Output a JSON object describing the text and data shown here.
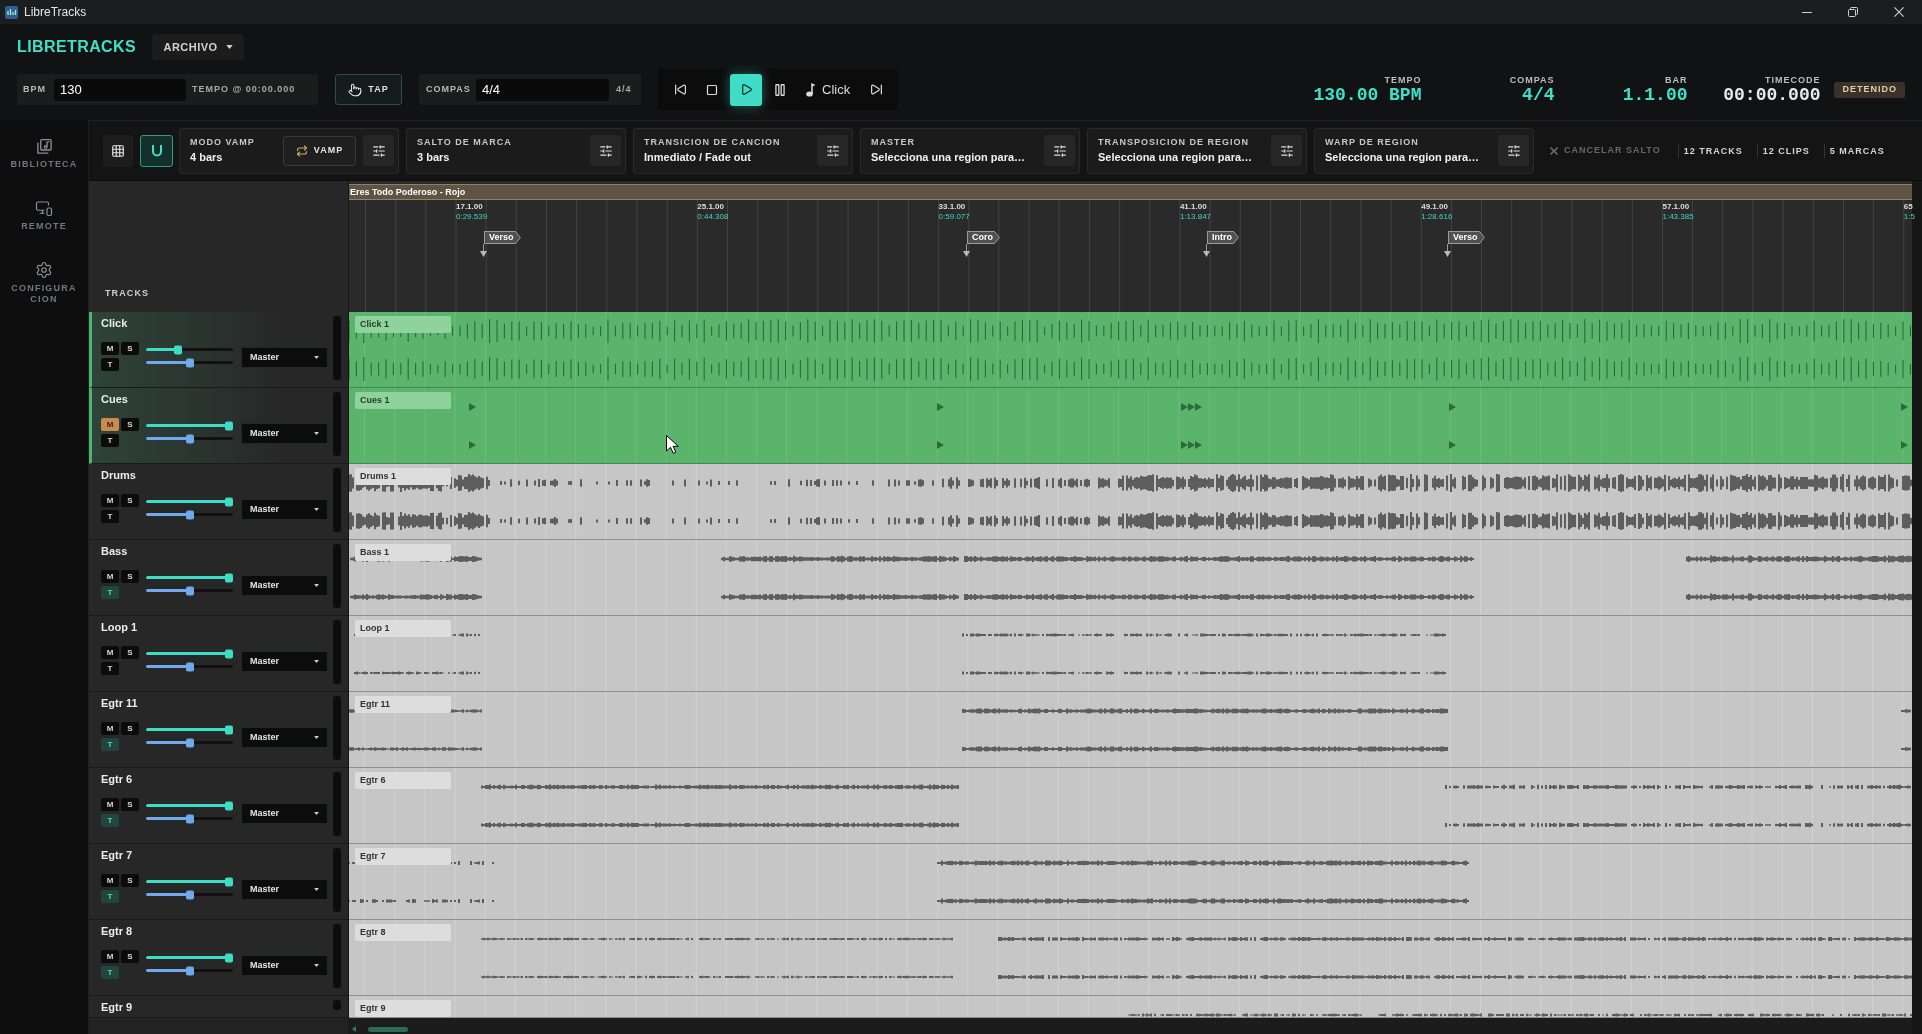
{
  "window": {
    "title": "LibreTracks"
  },
  "header": {
    "logo": "LIBRETRACKS",
    "menu": "ARCHIVO",
    "bpm": {
      "label": "BPM",
      "value": "130",
      "note": "TEMPO @ 00:00.000"
    },
    "tap": "TAP",
    "meter": {
      "label": "COMPAS",
      "value": "4/4",
      "note": "4/4"
    },
    "transport": [
      {
        "kind": "prev",
        "selected": false
      },
      {
        "kind": "stop",
        "selected": false
      },
      {
        "kind": "play",
        "selected": true
      },
      {
        "kind": "pause",
        "selected": false
      },
      {
        "kind": "click",
        "label": "Click",
        "selected": false
      },
      {
        "kind": "next",
        "selected": false
      }
    ],
    "readouts": [
      {
        "label": "TEMPO",
        "value": "130.00 BPM",
        "color": "#3fe0c7"
      },
      {
        "label": "COMPAS",
        "value": "4/4",
        "color": "#3fe0c7"
      },
      {
        "label": "BAR",
        "value": "1.1.00",
        "color": "#3fe0c7"
      },
      {
        "label": "TIMECODE",
        "value": "00:00.000",
        "color": "#e8e8e8"
      }
    ],
    "status": "DETENIDO"
  },
  "sidebar": {
    "items": [
      {
        "kind": "library",
        "label": "BIBLIOTECA"
      },
      {
        "kind": "remote",
        "label": "REMOTE"
      },
      {
        "kind": "settings",
        "label": "CONFIGURACION"
      }
    ]
  },
  "toolbar": {
    "tools": [
      {
        "kind": "grid",
        "selected": false
      },
      {
        "kind": "snap",
        "selected": true
      }
    ],
    "groups": [
      {
        "label": "MODO VAMP",
        "value": "4 bars",
        "action": "VAMP"
      },
      {
        "label": "SALTO DE MARCA",
        "value": "3 bars"
      },
      {
        "label": "TRANSICION DE CANCION",
        "value": "Inmediato / Fade out"
      },
      {
        "label": "MASTER",
        "value": "Selecciona una region para…"
      },
      {
        "label": "TRANSPOSICION DE REGION",
        "value": "Selecciona una region para…"
      },
      {
        "label": "WARP DE REGION",
        "value": "Selecciona una region para…"
      }
    ],
    "cancel": {
      "label": "CANCELAR SALTO",
      "disabled": true
    },
    "counts": [
      "12 TRACKS",
      "12 CLIPS",
      "5 MARCAS"
    ]
  },
  "tracks_panel": {
    "title": "TRACKS"
  },
  "ruler": {
    "song": "Eres Todo Poderoso - Rojo",
    "bars": [
      {
        "bar": "17.1.00",
        "time": "0:29.539"
      },
      {
        "bar": "25.1.00",
        "time": "0:44.308"
      },
      {
        "bar": "33.1.00",
        "time": "0:59.077"
      },
      {
        "bar": "41.1.00",
        "time": "1:13.847"
      },
      {
        "bar": "49.1.00",
        "time": "1:28.616"
      },
      {
        "bar": "57.1.00",
        "time": "1:43.385"
      },
      {
        "bar": "65",
        "time": "1:5"
      }
    ],
    "markers": [
      {
        "label": "Verso"
      },
      {
        "label": "Coro"
      },
      {
        "label": "Intro"
      },
      {
        "label": "Verso"
      }
    ]
  },
  "tracks": [
    {
      "name": "Click",
      "selected": true,
      "buttons": [
        {
          "kind": "mute",
          "label": "M",
          "on": false
        },
        {
          "kind": "solo",
          "label": "S",
          "on": false
        },
        {
          "kind": "t",
          "label": "T",
          "on": false
        }
      ],
      "volume": {
        "level": 0.37
      },
      "pan": {
        "level": 0.5
      },
      "output": "Master",
      "clip": "Click 1"
    },
    {
      "name": "Cues",
      "selected": true,
      "buttons": [
        {
          "kind": "mute",
          "label": "M",
          "on": true
        },
        {
          "kind": "solo",
          "label": "S",
          "on": false
        },
        {
          "kind": "t",
          "label": "T",
          "on": false
        }
      ],
      "volume": {
        "level": 0.95
      },
      "pan": {
        "level": 0.5
      },
      "output": "Master",
      "clip": "Cues 1"
    },
    {
      "name": "Drums",
      "selected": false,
      "buttons": [
        {
          "kind": "mute",
          "label": "M",
          "on": false
        },
        {
          "kind": "solo",
          "label": "S",
          "on": false
        },
        {
          "kind": "t",
          "label": "T",
          "on": false
        }
      ],
      "volume": {
        "level": 0.95
      },
      "pan": {
        "level": 0.5
      },
      "output": "Master",
      "clip": "Drums 1"
    },
    {
      "name": "Bass",
      "selected": false,
      "buttons": [
        {
          "kind": "mute",
          "label": "M",
          "on": false
        },
        {
          "kind": "solo",
          "label": "S",
          "on": false
        },
        {
          "kind": "t",
          "label": "T",
          "on": true
        }
      ],
      "volume": {
        "level": 0.95
      },
      "pan": {
        "level": 0.5
      },
      "output": "Master",
      "clip": "Bass 1"
    },
    {
      "name": "Loop 1",
      "selected": false,
      "buttons": [
        {
          "kind": "mute",
          "label": "M",
          "on": false
        },
        {
          "kind": "solo",
          "label": "S",
          "on": false
        },
        {
          "kind": "t",
          "label": "T",
          "on": false
        }
      ],
      "volume": {
        "level": 0.95
      },
      "pan": {
        "level": 0.5
      },
      "output": "Master",
      "clip": "Loop 1"
    },
    {
      "name": "Egtr 11",
      "selected": false,
      "buttons": [
        {
          "kind": "mute",
          "label": "M",
          "on": false
        },
        {
          "kind": "solo",
          "label": "S",
          "on": false
        },
        {
          "kind": "t",
          "label": "T",
          "on": true
        }
      ],
      "volume": {
        "level": 0.95
      },
      "pan": {
        "level": 0.5
      },
      "output": "Master",
      "clip": "Egtr 11"
    },
    {
      "name": "Egtr 6",
      "selected": false,
      "buttons": [
        {
          "kind": "mute",
          "label": "M",
          "on": false
        },
        {
          "kind": "solo",
          "label": "S",
          "on": false
        },
        {
          "kind": "t",
          "label": "T",
          "on": true
        }
      ],
      "volume": {
        "level": 0.95
      },
      "pan": {
        "level": 0.5
      },
      "output": "Master",
      "clip": "Egtr 6"
    },
    {
      "name": "Egtr 7",
      "selected": false,
      "buttons": [
        {
          "kind": "mute",
          "label": "M",
          "on": false
        },
        {
          "kind": "solo",
          "label": "S",
          "on": false
        },
        {
          "kind": "t",
          "label": "T",
          "on": true
        }
      ],
      "volume": {
        "level": 0.95
      },
      "pan": {
        "level": 0.5
      },
      "output": "Master",
      "clip": "Egtr 7"
    },
    {
      "name": "Egtr 8",
      "selected": false,
      "buttons": [
        {
          "kind": "mute",
          "label": "M",
          "on": false
        },
        {
          "kind": "solo",
          "label": "S",
          "on": false
        },
        {
          "kind": "t",
          "label": "T",
          "on": true
        }
      ],
      "volume": {
        "level": 0.95
      },
      "pan": {
        "level": 0.5
      },
      "output": "Master",
      "clip": "Egtr 8"
    },
    {
      "name": "Egtr 9",
      "selected": false,
      "clip": "Egtr 9"
    }
  ]
}
